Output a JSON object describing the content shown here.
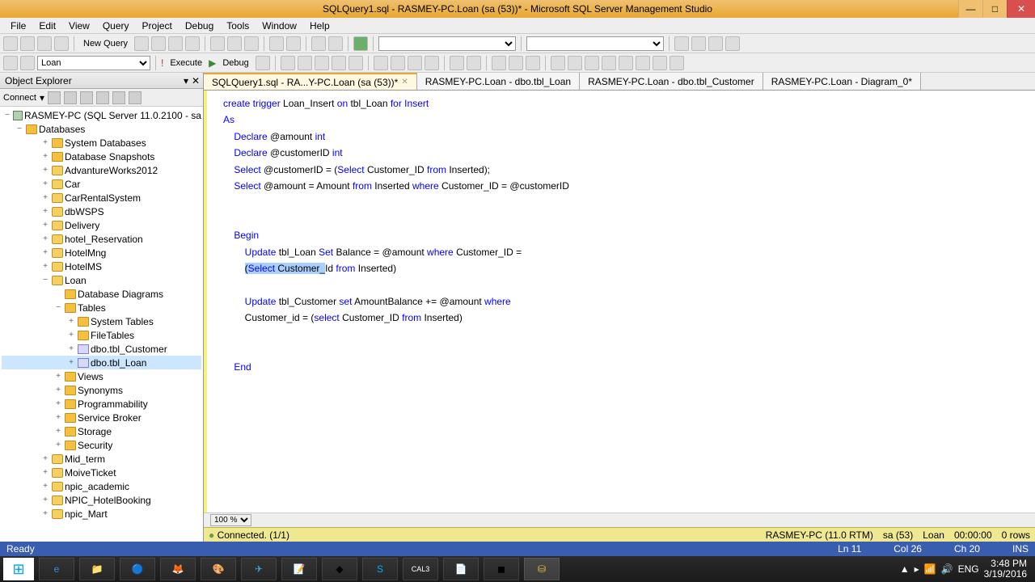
{
  "window": {
    "title": "SQLQuery1.sql - RASMEY-PC.Loan (sa (53))* - Microsoft SQL Server Management Studio"
  },
  "menu": [
    "File",
    "Edit",
    "View",
    "Query",
    "Project",
    "Debug",
    "Tools",
    "Window",
    "Help"
  ],
  "toolbar1": {
    "new_query": "New Query",
    "db_select": "Loan"
  },
  "toolbar2": {
    "execute": "Execute",
    "debug": "Debug"
  },
  "obj_explorer": {
    "title": "Object Explorer",
    "connect": "Connect"
  },
  "tree": {
    "server": "RASMEY-PC (SQL Server 11.0.2100 - sa",
    "databases": "Databases",
    "items": [
      {
        "label": "System Databases",
        "depth": 3,
        "exp": "+",
        "icon": "folder"
      },
      {
        "label": "Database Snapshots",
        "depth": 3,
        "exp": "+",
        "icon": "folder"
      },
      {
        "label": "AdvantureWorks2012",
        "depth": 3,
        "exp": "+",
        "icon": "db"
      },
      {
        "label": "Car",
        "depth": 3,
        "exp": "+",
        "icon": "db"
      },
      {
        "label": "CarRentalSystem",
        "depth": 3,
        "exp": "+",
        "icon": "db"
      },
      {
        "label": "dbWSPS",
        "depth": 3,
        "exp": "+",
        "icon": "db"
      },
      {
        "label": "Delivery",
        "depth": 3,
        "exp": "+",
        "icon": "db"
      },
      {
        "label": "hotel_Reservation",
        "depth": 3,
        "exp": "+",
        "icon": "db"
      },
      {
        "label": "HotelMng",
        "depth": 3,
        "exp": "+",
        "icon": "db"
      },
      {
        "label": "HotelMS",
        "depth": 3,
        "exp": "+",
        "icon": "db"
      },
      {
        "label": "Loan",
        "depth": 3,
        "exp": "−",
        "icon": "db"
      },
      {
        "label": "Database Diagrams",
        "depth": 4,
        "exp": "",
        "icon": "folder"
      },
      {
        "label": "Tables",
        "depth": 4,
        "exp": "−",
        "icon": "folder"
      },
      {
        "label": "System Tables",
        "depth": 5,
        "exp": "+",
        "icon": "folder"
      },
      {
        "label": "FileTables",
        "depth": 5,
        "exp": "+",
        "icon": "folder"
      },
      {
        "label": "dbo.tbl_Customer",
        "depth": 5,
        "exp": "+",
        "icon": "tbl"
      },
      {
        "label": "dbo.tbl_Loan",
        "depth": 5,
        "exp": "+",
        "icon": "tbl",
        "selected": true
      },
      {
        "label": "Views",
        "depth": 4,
        "exp": "+",
        "icon": "folder"
      },
      {
        "label": "Synonyms",
        "depth": 4,
        "exp": "+",
        "icon": "folder"
      },
      {
        "label": "Programmability",
        "depth": 4,
        "exp": "+",
        "icon": "folder"
      },
      {
        "label": "Service Broker",
        "depth": 4,
        "exp": "+",
        "icon": "folder"
      },
      {
        "label": "Storage",
        "depth": 4,
        "exp": "+",
        "icon": "folder"
      },
      {
        "label": "Security",
        "depth": 4,
        "exp": "+",
        "icon": "folder"
      },
      {
        "label": "Mid_term",
        "depth": 3,
        "exp": "+",
        "icon": "db"
      },
      {
        "label": "MoiveTicket",
        "depth": 3,
        "exp": "+",
        "icon": "db"
      },
      {
        "label": "npic_academic",
        "depth": 3,
        "exp": "+",
        "icon": "db"
      },
      {
        "label": "NPIC_HotelBooking",
        "depth": 3,
        "exp": "+",
        "icon": "db"
      },
      {
        "label": "npic_Mart",
        "depth": 3,
        "exp": "+",
        "icon": "db"
      }
    ]
  },
  "tabs": [
    {
      "label": "SQLQuery1.sql - RA...Y-PC.Loan (sa (53))*",
      "active": true,
      "close": true
    },
    {
      "label": "RASMEY-PC.Loan - dbo.tbl_Loan",
      "active": false
    },
    {
      "label": "RASMEY-PC.Loan - dbo.tbl_Customer",
      "active": false
    },
    {
      "label": "RASMEY-PC.Loan - Diagram_0*",
      "active": false
    }
  ],
  "zoom": "100 %",
  "conn_status": {
    "left": "Connected. (1/1)",
    "server": "RASMEY-PC (11.0 RTM)",
    "user": "sa (53)",
    "db": "Loan",
    "time": "00:00:00",
    "rows": "0 rows"
  },
  "status": {
    "ready": "Ready",
    "ln": "Ln 11",
    "col": "Col 26",
    "ch": "Ch 20",
    "ins": "INS"
  },
  "tray": {
    "lang": "ENG",
    "time": "3:48 PM",
    "date": "3/19/2016"
  },
  "code": {
    "l1_a": "create trigger",
    "l1_b": " Loan_Insert ",
    "l1_c": "on",
    "l1_d": " tbl_Loan ",
    "l1_e": "for Insert",
    "l2": "As",
    "l3_a": "Declare",
    "l3_b": " @amount ",
    "l3_c": "int",
    "l4_a": "Declare",
    "l4_b": " @customerID ",
    "l4_c": "int",
    "l5_a": "Select",
    "l5_b": " @customerID ",
    "l5_c": "=",
    "l5_d": " (",
    "l5_e": "Select",
    "l5_f": " Customer_ID ",
    "l5_g": "from",
    "l5_h": " Inserted",
    "l5_i": ");",
    "l6_a": "Select",
    "l6_b": " @amount ",
    "l6_c": "=",
    "l6_d": " Amount ",
    "l6_e": "from",
    "l6_f": " Inserted ",
    "l6_g": "where",
    "l6_h": " Customer_ID ",
    "l6_i": "=",
    "l6_j": " @customerID",
    "l8": "Begin",
    "l9_a": "Update",
    "l9_b": " tbl_Loan ",
    "l9_c": "Set",
    "l9_d": " Balance ",
    "l9_e": "=",
    "l9_f": " @amount ",
    "l9_g": "where",
    "l9_h": " Customer_ID ",
    "l9_i": "=",
    "l10_a": "(",
    "l10_b": "Select",
    "l10_c": " Customer_",
    "l10_d": "Id ",
    "l10_e": "from",
    "l10_f": " Inserted",
    "l10_g": ")",
    "l12_a": "Update",
    "l12_b": " tbl_Customer ",
    "l12_c": "set",
    "l12_d": " AmountBalance ",
    "l12_e": "+=",
    "l12_f": " @amount ",
    "l12_g": "where",
    "l13_a": "Customer_id ",
    "l13_b": "=",
    "l13_c": " (",
    "l13_d": "select",
    "l13_e": " Customer_ID ",
    "l13_f": "from",
    "l13_g": " Inserted",
    "l13_h": ")",
    "l16": "End"
  }
}
